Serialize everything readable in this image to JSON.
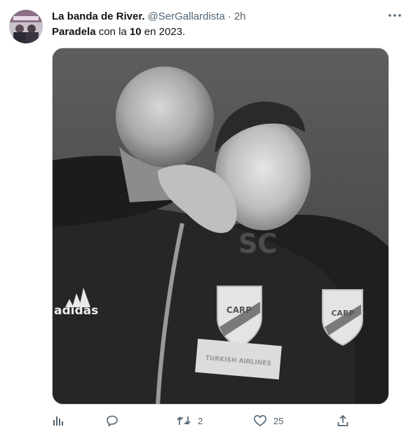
{
  "tweet": {
    "author_name": "La banda de River.",
    "author_handle": "@SerGallardista",
    "separator": "·",
    "time": "2h",
    "text_parts": [
      "Paradela",
      " con la ",
      "10",
      " en 2023."
    ],
    "media": {
      "watermark": "SC",
      "crest_text": "CARP",
      "brand_text": "adidas",
      "sponsor_text": "TURKISH AIRLINES"
    },
    "actions": {
      "analytics_icon": "analytics-icon",
      "reply_icon": "reply-icon",
      "retweet_icon": "retweet-icon",
      "retweet_count": "2",
      "like_icon": "heart-icon",
      "like_count": "25",
      "share_icon": "share-icon"
    }
  },
  "colors": {
    "text_primary": "#0f1419",
    "text_secondary": "#536471",
    "border": "#cfd9de"
  }
}
